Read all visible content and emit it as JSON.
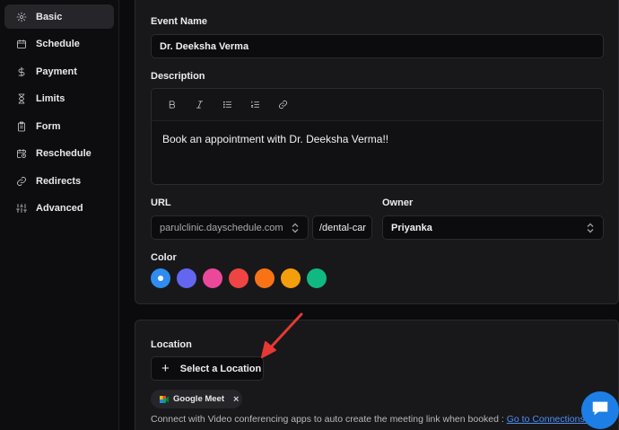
{
  "sidebar": {
    "items": [
      {
        "label": "Basic",
        "icon": "gear-icon",
        "active": true
      },
      {
        "label": "Schedule",
        "icon": "calendar-icon",
        "active": false
      },
      {
        "label": "Payment",
        "icon": "dollar-icon",
        "active": false
      },
      {
        "label": "Limits",
        "icon": "hourglass-icon",
        "active": false
      },
      {
        "label": "Form",
        "icon": "clipboard-icon",
        "active": false
      },
      {
        "label": "Reschedule",
        "icon": "calendar-clock-icon",
        "active": false
      },
      {
        "label": "Redirects",
        "icon": "link-icon",
        "active": false
      },
      {
        "label": "Advanced",
        "icon": "sliders-icon",
        "active": false
      }
    ]
  },
  "event_name": {
    "label": "Event Name",
    "value": "Dr. Deeksha Verma"
  },
  "description": {
    "label": "Description",
    "toolbar": [
      "bold-icon",
      "italic-icon",
      "bullet-list-icon",
      "numbered-list-icon",
      "link-icon"
    ],
    "text": "Book an appointment with Dr. Deeksha Verma!!"
  },
  "url": {
    "label": "URL",
    "domain": "parulclinic.dayschedule.com",
    "slug": "/dental-car"
  },
  "owner": {
    "label": "Owner",
    "value": "Priyanka"
  },
  "color": {
    "label": "Color",
    "swatches": [
      "#2f8cf0",
      "#6366f1",
      "#ec4899",
      "#ef4444",
      "#f97316",
      "#f59e0b",
      "#10b981"
    ],
    "selected_index": 0
  },
  "location": {
    "label": "Location",
    "button_label": "Select a Location",
    "chip_label": "Google Meet",
    "help_text": "Connect with Video conferencing apps to auto create the meeting link when booked : ",
    "help_link": "Go to Connections →"
  },
  "accent_color": "#1d7fe6",
  "annotation_color": "#e53935"
}
